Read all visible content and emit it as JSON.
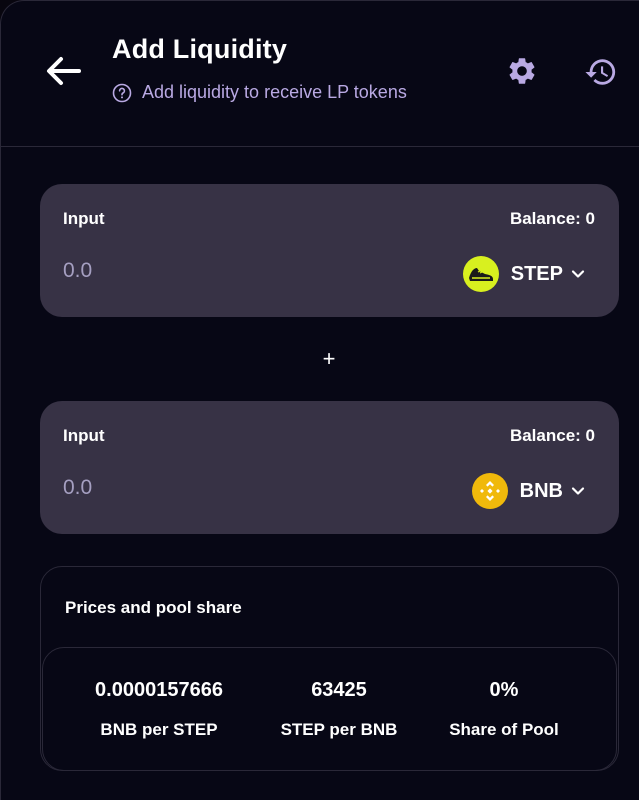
{
  "header": {
    "title": "Add Liquidity",
    "subtitle": "Add liquidity to receive LP tokens",
    "icons": [
      "back-arrow-icon",
      "help-circle-icon",
      "gear-icon",
      "history-icon"
    ]
  },
  "inputs": [
    {
      "label": "Input",
      "balance": "Balance: 0",
      "placeholder": "0.0",
      "token": "STEP",
      "token_icon": "step-sneaker-icon",
      "token_color": "#d8f01f"
    },
    {
      "label": "Input",
      "balance": "Balance: 0",
      "placeholder": "0.0",
      "token": "BNB",
      "token_icon": "bnb-icon",
      "token_color": "#f0b90b"
    }
  ],
  "plus": "+",
  "prices": {
    "title": "Prices and pool share",
    "stats": [
      {
        "value": "0.0000157666",
        "label": "BNB per STEP"
      },
      {
        "value": "63425",
        "label": "STEP per BNB"
      },
      {
        "value": "0%",
        "label": "Share of Pool"
      }
    ]
  },
  "colors": {
    "background": "#070715",
    "card": "#373245",
    "accent_text": "#b9a9e3",
    "muted_text": "#a59fc1",
    "border": "#2a2838"
  }
}
